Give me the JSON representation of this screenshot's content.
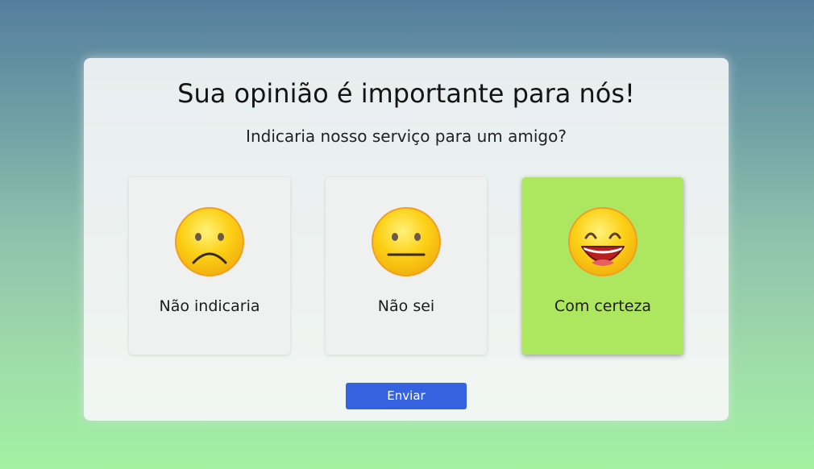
{
  "survey": {
    "title": "Sua opinião é importante para nós!",
    "question": "Indicaria nosso serviço para um amigo?",
    "options": [
      {
        "label": "Não indicaria",
        "icon": "sad-face-icon",
        "selected": false
      },
      {
        "label": "Não sei",
        "icon": "neutral-face-icon",
        "selected": false
      },
      {
        "label": "Com certeza",
        "icon": "happy-face-icon",
        "selected": true
      }
    ],
    "submit_label": "Enviar"
  },
  "colors": {
    "selected_option": "#ade65f",
    "submit_button": "#3563df",
    "emoji_fill": "#fcd116",
    "emoji_outline": "#f0a020"
  }
}
